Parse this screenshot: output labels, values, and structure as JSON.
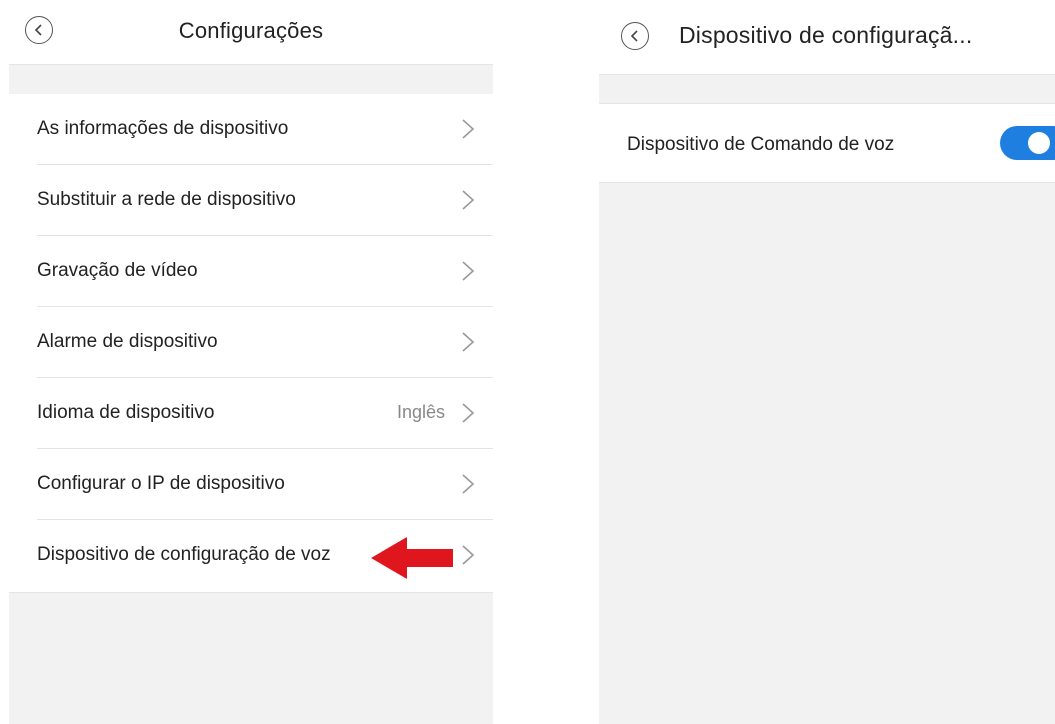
{
  "left_screen": {
    "title": "Configurações",
    "items": [
      {
        "label": "As informações de dispositivo",
        "value": ""
      },
      {
        "label": "Substituir a rede de dispositivo",
        "value": ""
      },
      {
        "label": "Gravação de vídeo",
        "value": ""
      },
      {
        "label": "Alarme de dispositivo",
        "value": ""
      },
      {
        "label": "Idioma de dispositivo",
        "value": "Inglês"
      },
      {
        "label": "Configurar o IP de dispositivo",
        "value": ""
      },
      {
        "label": "Dispositivo de configuração de voz",
        "value": ""
      }
    ]
  },
  "right_screen": {
    "title": "Dispositivo de configuraçã...",
    "setting": {
      "label": "Dispositivo de Comando de voz",
      "toggle_on": true
    }
  },
  "colors": {
    "accent": "#1e7fe0",
    "arrow": "#e0161e",
    "background_gray": "#f2f2f2",
    "value_gray": "#888888"
  },
  "icons": {
    "back": "chevron-left-circle-icon",
    "row_chevron": "chevron-right-icon",
    "annotation": "red-arrow-icon"
  }
}
